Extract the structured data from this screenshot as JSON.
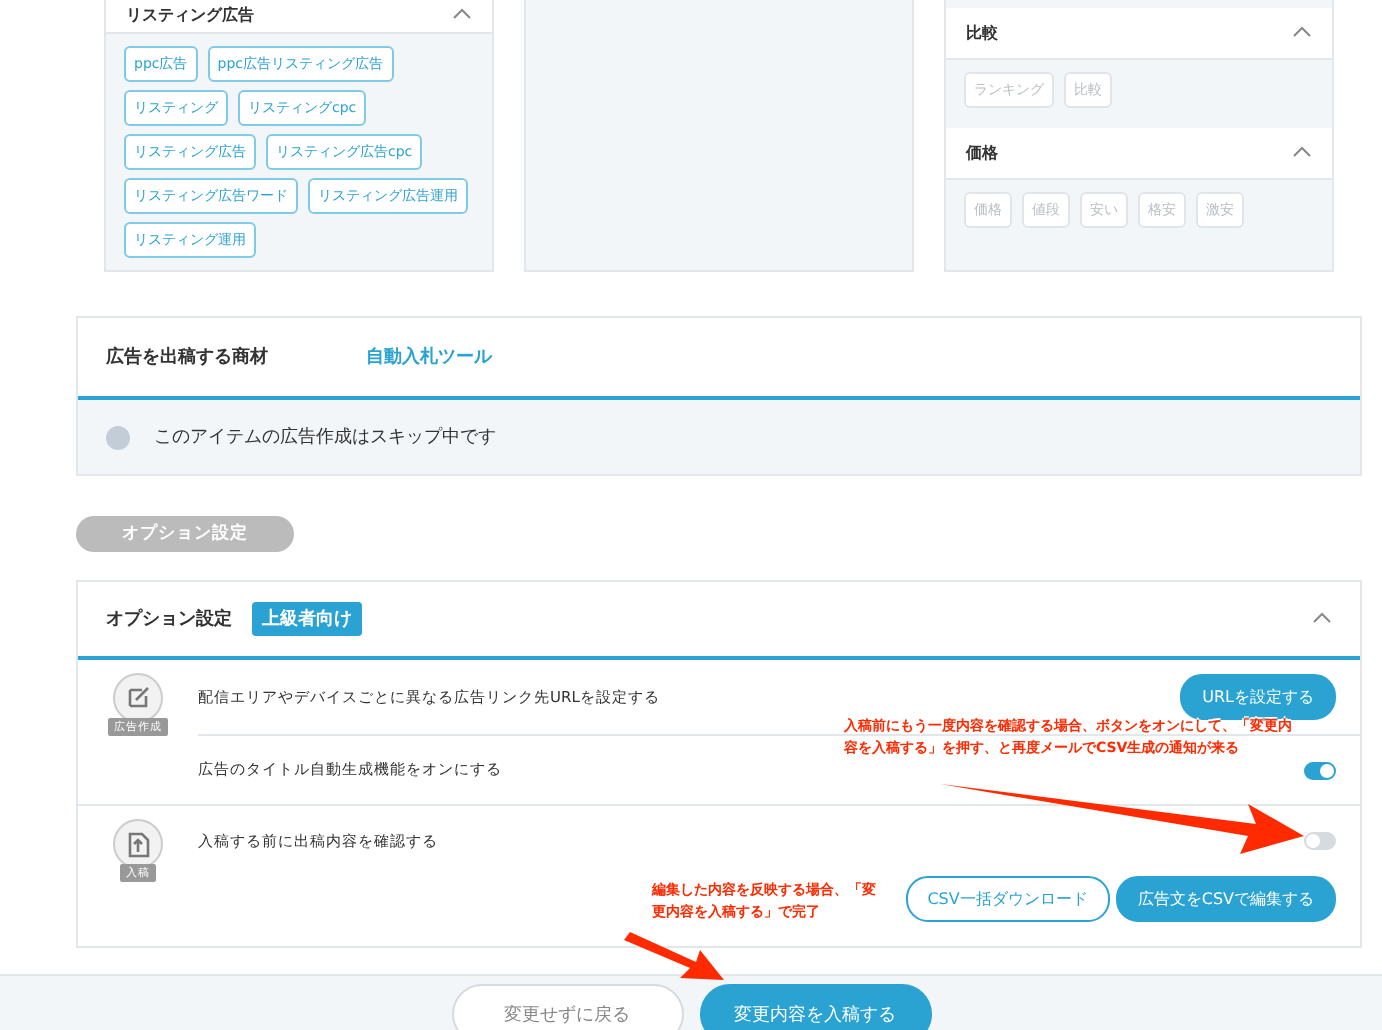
{
  "keyword_panels": [
    {
      "groups": [
        {
          "title": "リスティング広告",
          "expanded": true,
          "tags": [
            {
              "label": "ppc広告",
              "selected": true
            },
            {
              "label": "ppc広告リスティング広告",
              "selected": true
            },
            {
              "label": "リスティング",
              "selected": true
            },
            {
              "label": "リスティングcpc",
              "selected": true
            },
            {
              "label": "リスティング広告",
              "selected": true
            },
            {
              "label": "リスティング広告cpc",
              "selected": true
            },
            {
              "label": "リスティング広告ワード",
              "selected": true
            },
            {
              "label": "リスティング広告運用",
              "selected": true
            },
            {
              "label": "リスティング運用",
              "selected": true
            }
          ]
        }
      ]
    },
    {
      "groups": [
        {
          "title": "比較",
          "expanded": true,
          "tags": [
            {
              "label": "ランキング",
              "selected": false
            },
            {
              "label": "比較",
              "selected": false
            }
          ]
        },
        {
          "title": "価格",
          "expanded": true,
          "tags": [
            {
              "label": "価格",
              "selected": false
            },
            {
              "label": "値段",
              "selected": false
            },
            {
              "label": "安い",
              "selected": false
            },
            {
              "label": "格安",
              "selected": false
            },
            {
              "label": "激安",
              "selected": false
            }
          ]
        }
      ]
    }
  ],
  "product": {
    "label": "広告を出稿する商材",
    "value": "自動入札ツール",
    "notice": "このアイテムの広告作成はスキップ中です"
  },
  "option_pill": "オプション設定",
  "options": {
    "title": "オプション設定",
    "badge": "上級者向け",
    "expanded": true,
    "sections": [
      {
        "icon_label": "広告作成",
        "rows": [
          {
            "kind": "button",
            "label": "配信エリアやデバイスごとに異なる広告リンク先URLを設定する",
            "button": "URLを設定する"
          },
          {
            "kind": "toggle",
            "label": "広告のタイトル自動生成機能をオンにする",
            "on": true
          }
        ]
      },
      {
        "icon_label": "入稿",
        "rows": [
          {
            "kind": "toggle",
            "label": "入稿する前に出稿内容を確認する",
            "on": false
          }
        ],
        "actions": [
          {
            "label": "CSV一括ダウンロード",
            "primary": false
          },
          {
            "label": "広告文をCSVで編集する",
            "primary": true
          }
        ]
      }
    ]
  },
  "annotations": [
    "入稿前にもう一度内容を確認する場合、ボタンをオンにして、「変更内容を入稿する」を押す、と再度メールでCSV生成の通知が来る",
    "編集した内容を反映する場合、「変更内容を入稿する」で完了"
  ],
  "footer": [
    {
      "label": "変更せずに戻る",
      "primary": false
    },
    {
      "label": "変更内容を入稿する",
      "primary": true
    }
  ]
}
